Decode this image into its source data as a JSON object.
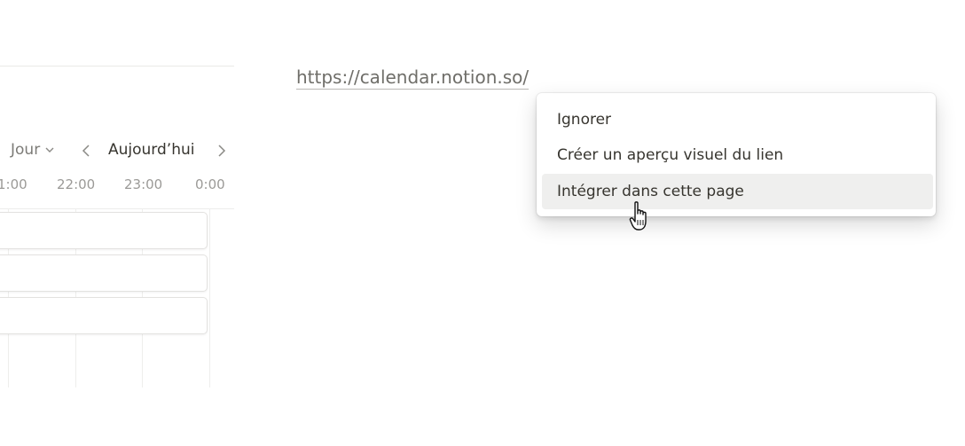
{
  "calendar": {
    "view_label": "Jour",
    "today_label": "Aujourd’hui",
    "hours": [
      "1:00",
      "22:00",
      "23:00",
      "0:00"
    ],
    "event_count_visible": 3
  },
  "url_text": "https://calendar.notion.so/",
  "menu": {
    "items": [
      {
        "label": "Ignorer"
      },
      {
        "label": "Créer un aperçu visuel du lien"
      },
      {
        "label": "Intégrer dans cette page"
      }
    ],
    "hovered_index": 2
  },
  "icons": {
    "view_chevron": "chevron-down-icon",
    "prev": "chevron-left-icon",
    "next": "chevron-right-icon",
    "cursor": "hand-pointer-cursor-icon"
  },
  "colors": {
    "text": "#37352f",
    "muted": "#7c7b77",
    "hover_bg": "#efefee",
    "border": "#e9e9e7"
  }
}
